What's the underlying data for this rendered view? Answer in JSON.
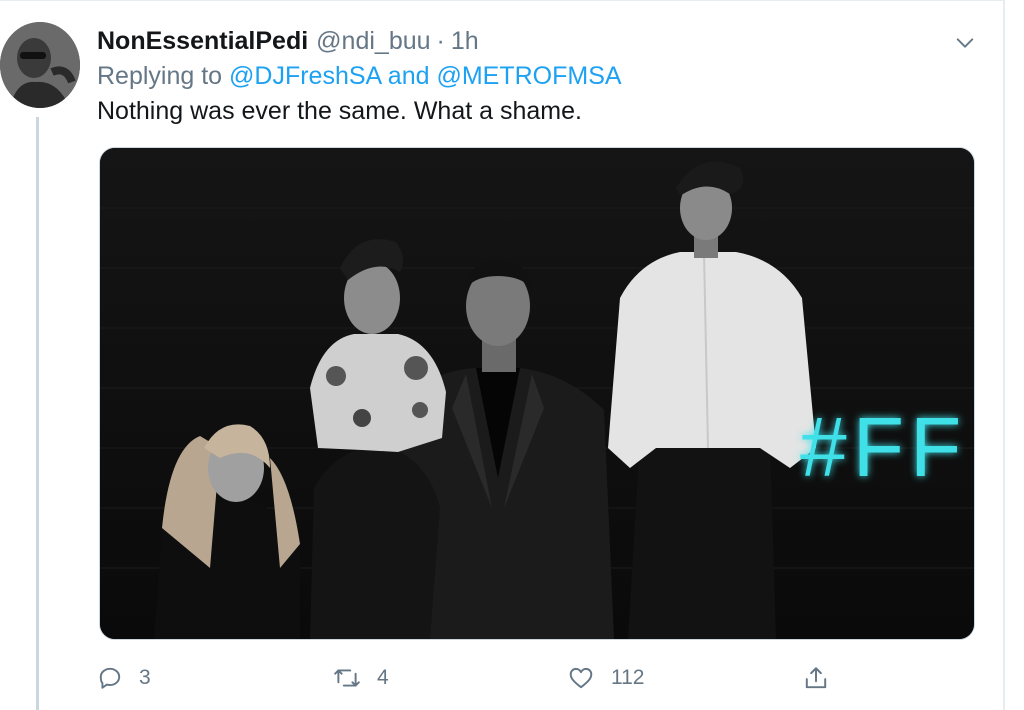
{
  "tweet": {
    "display_name": "NonEssentialPedi",
    "handle": "@ndi_buu",
    "separator": "·",
    "time": "1h",
    "replying_prefix": "Replying to",
    "reply_user_1": "@DJFreshSA",
    "reply_conjunction": "and",
    "reply_user_2": "@METROFMSA",
    "text": "Nothing was ever the same. What a shame.",
    "media_neon_text": "#FF"
  },
  "actions": {
    "replies": "3",
    "retweets": "4",
    "likes": "112"
  },
  "icons": {
    "reply": "reply-icon",
    "retweet": "retweet-icon",
    "like": "heart-icon",
    "share": "share-icon",
    "caret": "chevron-down-icon"
  },
  "colors": {
    "link": "#1da1f2",
    "muted": "#657786",
    "text": "#14171a",
    "neon": "#3fe0e8"
  }
}
